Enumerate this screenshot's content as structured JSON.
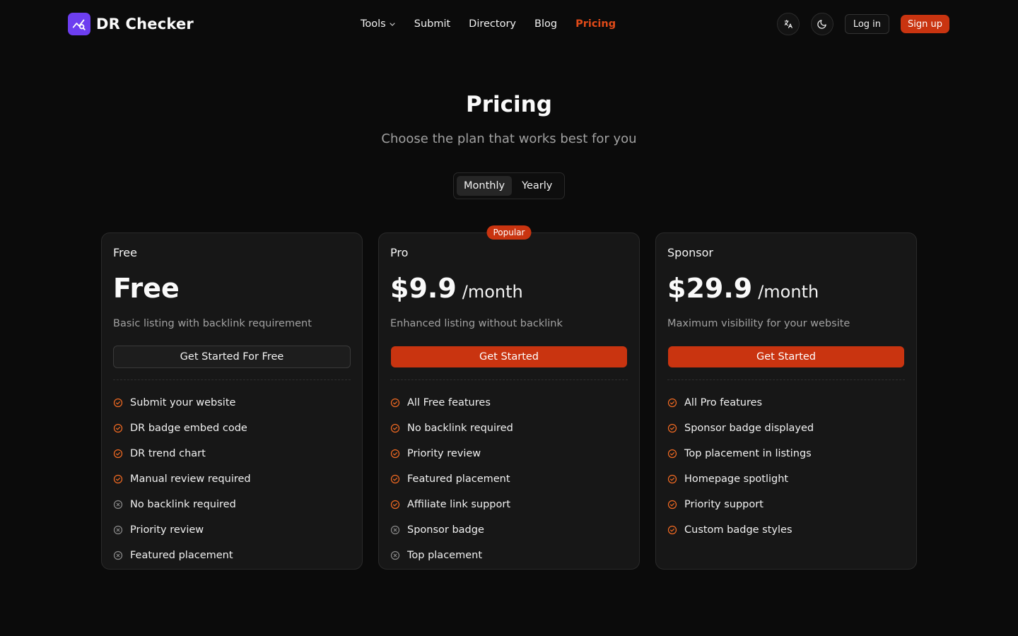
{
  "brand": {
    "name": "DR Checker",
    "logo_icon": "chart-search-icon",
    "logo_color": "#6d3ef0"
  },
  "nav": {
    "items": [
      {
        "label": "Tools",
        "has_dropdown": true
      },
      {
        "label": "Submit"
      },
      {
        "label": "Directory"
      },
      {
        "label": "Blog"
      },
      {
        "label": "Pricing",
        "active": true
      }
    ]
  },
  "header_actions": {
    "language_icon": "translate-icon",
    "theme_icon": "moon-icon",
    "login_label": "Log in",
    "signup_label": "Sign up"
  },
  "hero": {
    "title": "Pricing",
    "subtitle": "Choose the plan that works best for you"
  },
  "billing_toggle": {
    "options": [
      "Monthly",
      "Yearly"
    ],
    "selected": "Monthly"
  },
  "plans": [
    {
      "name": "Free",
      "price": "Free",
      "period": "",
      "description": "Basic listing with backlink requirement",
      "button_label": "Get Started For Free",
      "popular": false,
      "features": [
        {
          "text": "Submit your website",
          "included": true
        },
        {
          "text": "DR badge embed code",
          "included": true
        },
        {
          "text": "DR trend chart",
          "included": true
        },
        {
          "text": "Manual review required",
          "included": true
        },
        {
          "text": "No backlink required",
          "included": false
        },
        {
          "text": "Priority review",
          "included": false
        },
        {
          "text": "Featured placement",
          "included": false
        }
      ]
    },
    {
      "name": "Pro",
      "price": "$9.9",
      "period": "/month",
      "description": "Enhanced listing without backlink",
      "button_label": "Get Started",
      "popular": true,
      "popular_label": "Popular",
      "features": [
        {
          "text": "All Free features",
          "included": true
        },
        {
          "text": "No backlink required",
          "included": true
        },
        {
          "text": "Priority review",
          "included": true
        },
        {
          "text": "Featured placement",
          "included": true
        },
        {
          "text": "Affiliate link support",
          "included": true
        },
        {
          "text": "Sponsor badge",
          "included": false
        },
        {
          "text": "Top placement",
          "included": false
        }
      ]
    },
    {
      "name": "Sponsor",
      "price": "$29.9",
      "period": "/month",
      "description": "Maximum visibility for your website",
      "button_label": "Get Started",
      "popular": false,
      "features": [
        {
          "text": "All Pro features",
          "included": true
        },
        {
          "text": "Sponsor badge displayed",
          "included": true
        },
        {
          "text": "Top placement in listings",
          "included": true
        },
        {
          "text": "Homepage spotlight",
          "included": true
        },
        {
          "text": "Priority support",
          "included": true
        },
        {
          "text": "Custom badge styles",
          "included": true
        }
      ]
    }
  ],
  "colors": {
    "accent": "#c93410",
    "accent_text": "#e04a18",
    "check": "#f26a22",
    "cross": "#8a8a8a",
    "background": "#0b0b0b",
    "card": "#171717"
  }
}
